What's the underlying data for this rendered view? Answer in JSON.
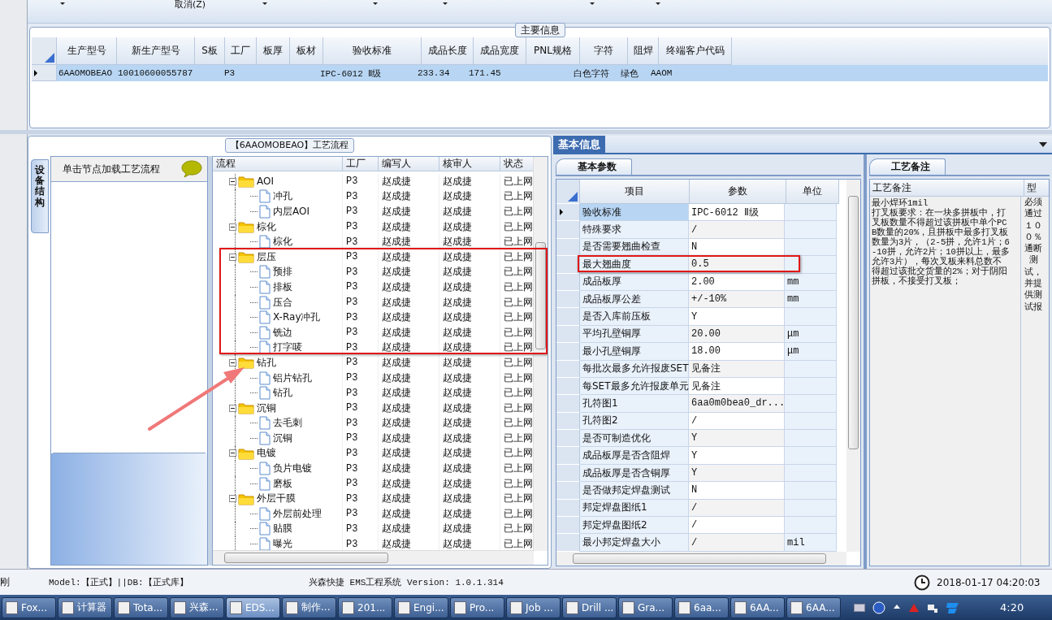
{
  "toolbar": {
    "cancel_label": "取消(Z)"
  },
  "main_info": {
    "title": "主要信息",
    "columns": [
      "生产型号",
      "新生产型号",
      "S板",
      "工厂",
      "板厚",
      "板材",
      "验收标准",
      "成品长度",
      "成品宽度",
      "PNL规格",
      "字符",
      "阻焊",
      "终端客户代码"
    ],
    "rows": [
      {
        "selected": true,
        "cells": [
          "6AAOMOBEAO",
          "10010600055787",
          null,
          "P3",
          null,
          null,
          "IPC-6012 Ⅱ级",
          "233.34",
          "171.45",
          null,
          "白色字符",
          "绿色",
          "AAOM"
        ]
      }
    ]
  },
  "process": {
    "title": "【6AAOMOBEAO】工艺流程",
    "side_tab": "设备结构",
    "hint": "单击节点加载工艺流程",
    "columns": [
      "流程",
      "工厂",
      "编写人",
      "核审人",
      "状态"
    ],
    "tree": [
      {
        "name": "AOI",
        "factory": "P3",
        "writer": "赵成捷",
        "reviewer": "赵成捷",
        "status": "已上网",
        "expanded": true,
        "children": [
          {
            "name": "冲孔",
            "factory": "P3",
            "writer": "赵成捷",
            "reviewer": "赵成捷",
            "status": "已上网"
          },
          {
            "name": "内层AOI",
            "factory": "P3",
            "writer": "赵成捷",
            "reviewer": "赵成捷",
            "status": "已上网"
          }
        ]
      },
      {
        "name": "棕化",
        "factory": "P3",
        "writer": "赵成捷",
        "reviewer": "赵成捷",
        "status": "已上网",
        "expanded": true,
        "children": [
          {
            "name": "棕化",
            "factory": "P3",
            "writer": "赵成捷",
            "reviewer": "赵成捷",
            "status": "已上网"
          }
        ]
      },
      {
        "name": "层压",
        "factory": "P3",
        "writer": "赵成捷",
        "reviewer": "赵成捷",
        "status": "已上网",
        "expanded": true,
        "children": [
          {
            "name": "预排",
            "factory": "P3",
            "writer": "赵成捷",
            "reviewer": "赵成捷",
            "status": "已上网"
          },
          {
            "name": "排板",
            "factory": "P3",
            "writer": "赵成捷",
            "reviewer": "赵成捷",
            "status": "已上网"
          },
          {
            "name": "压合",
            "factory": "P3",
            "writer": "赵成捷",
            "reviewer": "赵成捷",
            "status": "已上网"
          },
          {
            "name": "X-Ray冲孔",
            "factory": "P3",
            "writer": "赵成捷",
            "reviewer": "赵成捷",
            "status": "已上网"
          },
          {
            "name": "铣边",
            "factory": "P3",
            "writer": "赵成捷",
            "reviewer": "赵成捷",
            "status": "已上网"
          },
          {
            "name": "打字唛",
            "factory": "P3",
            "writer": "赵成捷",
            "reviewer": "赵成捷",
            "status": "已上网"
          }
        ]
      },
      {
        "name": "钻孔",
        "factory": "P3",
        "writer": "赵成捷",
        "reviewer": "赵成捷",
        "status": "已上网",
        "expanded": true,
        "children": [
          {
            "name": "铝片钻孔",
            "factory": "P3",
            "writer": "赵成捷",
            "reviewer": "赵成捷",
            "status": "已上网"
          },
          {
            "name": "钻孔",
            "factory": "P3",
            "writer": "赵成捷",
            "reviewer": "赵成捷",
            "status": "已上网"
          }
        ]
      },
      {
        "name": "沉铜",
        "factory": "P3",
        "writer": "赵成捷",
        "reviewer": "赵成捷",
        "status": "已上网",
        "expanded": true,
        "children": [
          {
            "name": "去毛刺",
            "factory": "P3",
            "writer": "赵成捷",
            "reviewer": "赵成捷",
            "status": "已上网"
          },
          {
            "name": "沉铜",
            "factory": "P3",
            "writer": "赵成捷",
            "reviewer": "赵成捷",
            "status": "已上网"
          }
        ]
      },
      {
        "name": "电镀",
        "factory": "P3",
        "writer": "赵成捷",
        "reviewer": "赵成捷",
        "status": "已上网",
        "expanded": true,
        "children": [
          {
            "name": "负片电镀",
            "factory": "P3",
            "writer": "赵成捷",
            "reviewer": "赵成捷",
            "status": "已上网"
          },
          {
            "name": "磨板",
            "factory": "P3",
            "writer": "赵成捷",
            "reviewer": "赵成捷",
            "status": "已上网"
          }
        ]
      },
      {
        "name": "外层干膜",
        "factory": "P3",
        "writer": "赵成捷",
        "reviewer": "赵成捷",
        "status": "已上网",
        "expanded": true,
        "children": [
          {
            "name": "外层前处理",
            "factory": "P3",
            "writer": "赵成捷",
            "reviewer": "赵成捷",
            "status": "已上网"
          },
          {
            "name": "贴膜",
            "factory": "P3",
            "writer": "赵成捷",
            "reviewer": "赵成捷",
            "status": "已上网"
          },
          {
            "name": "曝光",
            "factory": "P3",
            "writer": "赵成捷",
            "reviewer": "赵成捷",
            "status": "已上网"
          }
        ]
      }
    ]
  },
  "basic_info": {
    "tab": "基本信息",
    "subtab": "基本参数",
    "columns": [
      "项目",
      "参数",
      "单位"
    ],
    "rows": [
      {
        "item": "验收标准",
        "value": "IPC-6012 Ⅱ级",
        "selected": true
      },
      {
        "item": "特殊要求",
        "value": "/",
        "selected": false
      },
      {
        "item": "是否需要翘曲检查",
        "value": "N",
        "selected": false
      },
      {
        "item": "最大翘曲度",
        "value": "0.5",
        "selected": false
      },
      {
        "item": "成品板厚",
        "value": "2.00",
        "unit": "mm",
        "selected": false
      },
      {
        "item": "成品板厚公差",
        "value": "+/-10%",
        "unit": "mm",
        "selected": false
      },
      {
        "item": "是否入库前压板",
        "value": "Y",
        "selected": false
      },
      {
        "item": "平均孔壁铜厚",
        "value": "20.00",
        "unit": "μm",
        "selected": false
      },
      {
        "item": "最小孔壁铜厚",
        "value": "18.00",
        "unit": "μm",
        "selected": false
      },
      {
        "item": "每批次最多允许报废SET",
        "value": "见备注",
        "selected": false
      },
      {
        "item": "每SET最多允许报废单元",
        "value": "见备注",
        "selected": false
      },
      {
        "item": "孔符图1",
        "value": "6aa0m0bea0_dr...",
        "selected": false
      },
      {
        "item": "孔符图2",
        "value": "/",
        "selected": false
      },
      {
        "item": "是否可制造优化",
        "value": "Y",
        "selected": false
      },
      {
        "item": "成品板厚是否含阻焊",
        "value": "Y",
        "selected": false
      },
      {
        "item": "成品板厚是否含铜厚",
        "value": "Y",
        "selected": false
      },
      {
        "item": "是否做邦定焊盘测试",
        "value": "N",
        "selected": false
      },
      {
        "item": "邦定焊盘图纸1",
        "value": "/",
        "selected": false
      },
      {
        "item": "邦定焊盘图纸2",
        "value": "/",
        "selected": false
      },
      {
        "item": "最小邦定焊盘大小",
        "value": "/",
        "unit": "mil",
        "selected": false
      }
    ]
  },
  "notes": {
    "tab": "工艺备注",
    "columns": [
      "工艺备注",
      "型"
    ],
    "text": "最小焊环1mil\n打叉板要求：在一块多拼板中，打叉板数量不得超过该拼板中单个PCB数量的20%，且拼板中最多打叉板数量为3片，（2-5拼，允许1片；6-10拼，允许2片；10拼以上，最多允许3片），每次叉板来料总数不得超过该批交货量的2%；对于阴阳拼板，不接受打叉板；",
    "column_2_text": "必须通过１００％通断测试，并提供测试报"
  },
  "status_bar": {
    "user": "刚",
    "model": "Model:【正式】||DB:【正式库】",
    "title": "兴森快捷 EMS工程系统 Version: 1.0.1.314",
    "datetime": "2018-01-17 04:20:03"
  },
  "taskbar": {
    "items": [
      {
        "label": "Fox...",
        "selected": false
      },
      {
        "label": "计算器",
        "selected": false
      },
      {
        "label": "Tota...",
        "selected": false
      },
      {
        "label": "兴森...",
        "selected": false
      },
      {
        "label": "EDS...",
        "selected": true
      },
      {
        "label": "制作...",
        "selected": false
      },
      {
        "label": "201...",
        "selected": false
      },
      {
        "label": "Engi...",
        "selected": false
      },
      {
        "label": "Pro...",
        "selected": false
      },
      {
        "label": "Job ...",
        "selected": false
      },
      {
        "label": "Drill ...",
        "selected": false
      },
      {
        "label": "Gra...",
        "selected": false
      },
      {
        "label": "6aa...",
        "selected": false
      },
      {
        "label": "6AA...",
        "selected": false
      },
      {
        "label": "6AA...",
        "selected": false
      }
    ],
    "clock": "4:20"
  }
}
